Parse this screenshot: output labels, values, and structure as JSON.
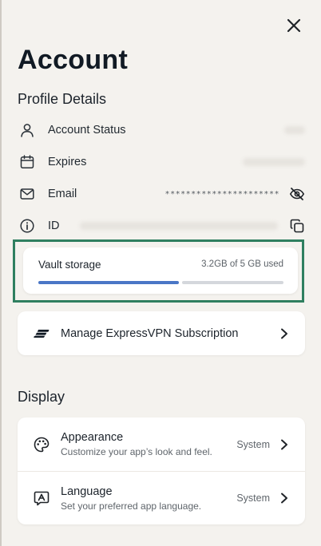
{
  "header": {
    "title": "Account",
    "close_icon": "close-icon"
  },
  "profile": {
    "section_title": "Profile Details",
    "rows": [
      {
        "label": "Account Status",
        "icon": "user-icon"
      },
      {
        "label": "Expires",
        "icon": "calendar-icon"
      },
      {
        "label": "Email",
        "icon": "mail-icon",
        "masked_value": "**********************",
        "action_icon": "eye-off-icon"
      },
      {
        "label": "ID",
        "icon": "info-icon",
        "action_icon": "copy-icon"
      }
    ]
  },
  "vault": {
    "label": "Vault storage",
    "usage": "3.2GB of 5 GB used",
    "used_fraction": 0.58,
    "accent": "#4a76c6",
    "highlight_color": "#2f7f60"
  },
  "subscription": {
    "label": "Manage ExpressVPN Subscription",
    "icon": "expressvpn-logo-icon"
  },
  "display": {
    "section_title": "Display",
    "items": [
      {
        "title": "Appearance",
        "subtitle": "Customize your app’s look and feel.",
        "value": "System",
        "icon": "palette-icon"
      },
      {
        "title": "Language",
        "subtitle": "Set your preferred app language.",
        "value": "System",
        "icon": "language-icon"
      }
    ]
  }
}
